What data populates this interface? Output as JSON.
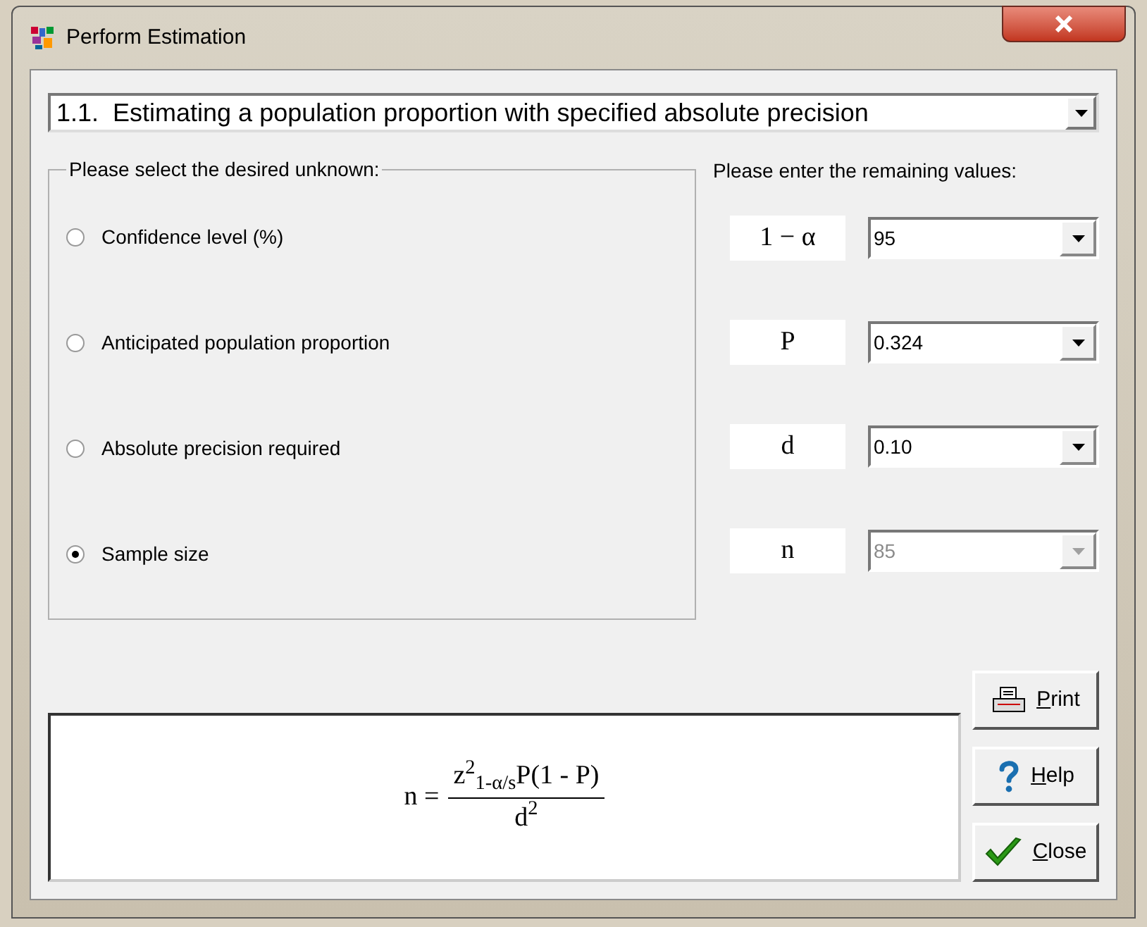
{
  "window": {
    "title": "Perform Estimation"
  },
  "method": {
    "value": "1.1.  Estimating a population proportion with specified absolute precision"
  },
  "unknown_group": {
    "title": "Please select the desired unknown:",
    "options": [
      {
        "label": "Confidence level (%)",
        "selected": false
      },
      {
        "label": "Anticipated population proportion",
        "selected": false
      },
      {
        "label": "Absolute precision required",
        "selected": false
      },
      {
        "label": "Sample size",
        "selected": true
      }
    ]
  },
  "values_heading": "Please enter the remaining values:",
  "values": [
    {
      "symbol": "1 − α",
      "value": "95",
      "disabled": false
    },
    {
      "symbol": "P",
      "value": "0.324",
      "disabled": false
    },
    {
      "symbol": "d",
      "value": "0.10",
      "disabled": false
    },
    {
      "symbol": "n",
      "value": "85",
      "disabled": true
    }
  ],
  "formula": {
    "lhs": "n =",
    "numerator": "z$^{2}$$_{1-α/s}$P(1 - P)",
    "denominator": "d$^{2}$"
  },
  "buttons": [
    {
      "kind": "print",
      "mnemonic": "P",
      "rest": "rint"
    },
    {
      "kind": "help",
      "mnemonic": "H",
      "rest": "elp"
    },
    {
      "kind": "close",
      "mnemonic": "C",
      "rest": "lose"
    }
  ]
}
